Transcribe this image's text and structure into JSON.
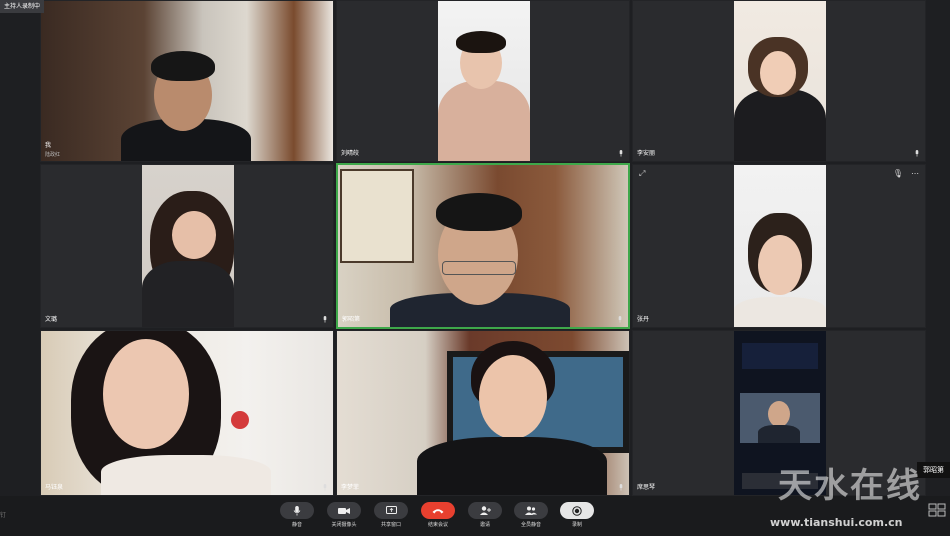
{
  "recording_badge": "主持人录制中",
  "participants": [
    {
      "name": "我",
      "sub": "陆政红"
    },
    {
      "name": "刘晴皎"
    },
    {
      "name": "李安丽"
    },
    {
      "name": "文璐"
    },
    {
      "name": "郭昭第"
    },
    {
      "name": "张丹"
    },
    {
      "name": "马钰泉"
    },
    {
      "name": "李梦菲"
    },
    {
      "name": "席思琴"
    }
  ],
  "toolbar": {
    "left_text": "钉",
    "buttons": [
      {
        "label": "静音",
        "icon": "mic-icon"
      },
      {
        "label": "关闭摄像头",
        "icon": "camera-icon"
      },
      {
        "label": "共享窗口",
        "icon": "share-screen-icon"
      },
      {
        "label": "结束会议",
        "icon": "hang-up-icon"
      },
      {
        "label": "邀请",
        "icon": "invite-icon"
      },
      {
        "label": "全员静音",
        "icon": "mute-all-icon"
      },
      {
        "label": "录制",
        "icon": "record-icon"
      }
    ]
  },
  "hover_name": "郭昭第",
  "watermark": {
    "main": "天水在线",
    "url": "www.tianshui.com.cn"
  },
  "colors": {
    "active_border": "#3ea84a",
    "end_call": "#e8402f",
    "background": "#1e1f22"
  }
}
